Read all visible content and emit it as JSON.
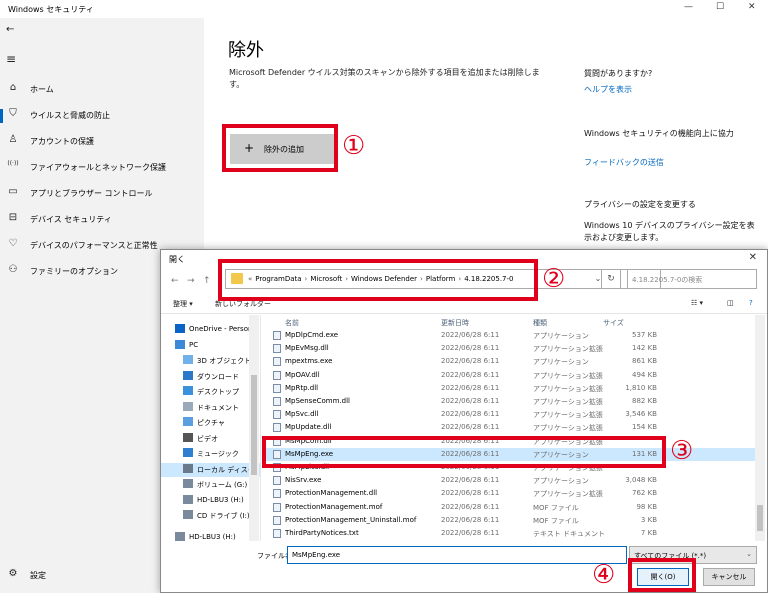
{
  "window": {
    "title": "Windows セキュリティ",
    "minimize": "—",
    "maximize": "☐",
    "close": "✕"
  },
  "sidebar": {
    "back_icon": "←",
    "menu_icon": "≡",
    "items": [
      {
        "icon": "⌂",
        "label": "ホーム",
        "selected": false
      },
      {
        "icon": "⛉",
        "label": "ウイルスと脅威の防止",
        "selected": true
      },
      {
        "icon": "♙",
        "label": "アカウントの保護",
        "selected": false
      },
      {
        "icon": "((·))",
        "label": "ファイアウォールとネットワーク保護",
        "selected": false
      },
      {
        "icon": "▭",
        "label": "アプリとブラウザー コントロール",
        "selected": false
      },
      {
        "icon": "⊟",
        "label": "デバイス セキュリティ",
        "selected": false
      },
      {
        "icon": "♡",
        "label": "デバイスのパフォーマンスと正常性",
        "selected": false
      },
      {
        "icon": "⚇",
        "label": "ファミリーのオプション",
        "selected": false
      }
    ],
    "settings": {
      "icon": "⚙",
      "label": "設定"
    }
  },
  "main": {
    "title": "除外",
    "description": "Microsoft Defender ウイルス対策のスキャンから除外する項目を追加または削除します。",
    "add_button": {
      "plus": "+",
      "label": "除外の追加"
    },
    "help": {
      "heading": "質問がありますか?",
      "link": "ヘルプを表示"
    },
    "improve": {
      "heading": "Windows セキュリティの機能向上に協力",
      "link": "フィードバックの送信"
    },
    "privacy": {
      "heading": "プライバシーの設定を変更する",
      "text": "Windows 10 デバイスのプライバシー設定を表示および変更します。"
    }
  },
  "annotations": [
    "①",
    "②",
    "③",
    "④"
  ],
  "dialog": {
    "title": "開く",
    "close": "✕",
    "nav": {
      "back": "←",
      "forward": "→",
      "up": "↑"
    },
    "breadcrumb": [
      "«",
      "ProgramData",
      "›",
      "Microsoft",
      "›",
      "Windows Defender",
      "›",
      "Platform",
      "›",
      "4.18.2205.7-0"
    ],
    "search_placeholder": "4.18.2205.7-0の検索",
    "toolbar": {
      "organize": "整理 ▾",
      "new_folder": "新しいフォルダー",
      "view": "☷ ▾",
      "pane": "◫",
      "help": "?"
    },
    "tree": [
      {
        "label": "OneDrive - Person",
        "icon_color": "#0a64c8",
        "indent": 14,
        "selected": false
      },
      {
        "label": "PC",
        "icon_color": "#3a8ad8",
        "indent": 14,
        "selected": false
      },
      {
        "label": "3D オブジェクト",
        "icon_color": "#6fb1e8",
        "indent": 22,
        "selected": false
      },
      {
        "label": "ダウンロード",
        "icon_color": "#2a78c8",
        "indent": 22,
        "selected": false
      },
      {
        "label": "デスクトップ",
        "icon_color": "#3c91dc",
        "indent": 22,
        "selected": false
      },
      {
        "label": "ドキュメント",
        "icon_color": "#9aa9bc",
        "indent": 22,
        "selected": false
      },
      {
        "label": "ピクチャ",
        "icon_color": "#5aa0e0",
        "indent": 22,
        "selected": false
      },
      {
        "label": "ビデオ",
        "icon_color": "#555555",
        "indent": 22,
        "selected": false
      },
      {
        "label": "ミュージック",
        "icon_color": "#2f7fd0",
        "indent": 22,
        "selected": false
      },
      {
        "label": "ローカル ディスク (C",
        "icon_color": "#6a7a8c",
        "indent": 22,
        "selected": true
      },
      {
        "label": "ボリューム (G:)",
        "icon_color": "#7a8a9c",
        "indent": 22,
        "selected": false
      },
      {
        "label": "HD-LBU3 (H:)",
        "icon_color": "#7a8a9c",
        "indent": 22,
        "selected": false
      },
      {
        "label": "CD ドライブ (I:)",
        "icon_color": "#7a8a9c",
        "indent": 22,
        "selected": false
      },
      {
        "label": "HD-LBU3 (H:)",
        "icon_color": "#7a8a9c",
        "indent": 14,
        "selected": false
      }
    ],
    "columns": {
      "name": "名前",
      "date": "更新日時",
      "type": "種類",
      "size": "サイズ"
    },
    "files": [
      {
        "name": "MpDlpCmd.exe",
        "date": "2022/06/28 6:11",
        "type": "アプリケーション",
        "size": "537 KB",
        "selected": false
      },
      {
        "name": "MpEvMsg.dll",
        "date": "2022/06/28 6:11",
        "type": "アプリケーション拡張",
        "size": "142 KB",
        "selected": false
      },
      {
        "name": "mpextms.exe",
        "date": "2022/06/28 6:11",
        "type": "アプリケーション",
        "size": "861 KB",
        "selected": false
      },
      {
        "name": "MpOAV.dll",
        "date": "2022/06/28 6:11",
        "type": "アプリケーション拡張",
        "size": "494 KB",
        "selected": false
      },
      {
        "name": "MpRtp.dll",
        "date": "2022/06/28 6:11",
        "type": "アプリケーション拡張",
        "size": "1,810 KB",
        "selected": false
      },
      {
        "name": "MpSenseComm.dll",
        "date": "2022/06/28 6:11",
        "type": "アプリケーション拡張",
        "size": "882 KB",
        "selected": false
      },
      {
        "name": "MpSvc.dll",
        "date": "2022/06/28 6:11",
        "type": "アプリケーション拡張",
        "size": "3,546 KB",
        "selected": false
      },
      {
        "name": "MpUpdate.dll",
        "date": "2022/06/28 6:11",
        "type": "アプリケーション拡張",
        "size": "154 KB",
        "selected": false
      },
      {
        "name": "MsMpCom.dll",
        "date": "2022/06/28 6:11",
        "type": "アプリケーション拡張",
        "size": "",
        "selected": false
      },
      {
        "name": "MsMpEng.exe",
        "date": "2022/06/28 6:11",
        "type": "アプリケーション",
        "size": "131 KB",
        "selected": true
      },
      {
        "name": "MsMpLics.dll",
        "date": "2022/06/28 6:11",
        "type": "アプリケーション拡張",
        "size": "",
        "selected": false
      },
      {
        "name": "NisSrv.exe",
        "date": "2022/06/28 6:11",
        "type": "アプリケーション",
        "size": "3,048 KB",
        "selected": false
      },
      {
        "name": "ProtectionManagement.dll",
        "date": "2022/06/28 6:11",
        "type": "アプリケーション拡張",
        "size": "762 KB",
        "selected": false
      },
      {
        "name": "ProtectionManagement.mof",
        "date": "2022/06/28 6:11",
        "type": "MOF ファイル",
        "size": "98 KB",
        "selected": false
      },
      {
        "name": "ProtectionManagement_Uninstall.mof",
        "date": "2022/06/28 6:11",
        "type": "MOF ファイル",
        "size": "3 KB",
        "selected": false
      },
      {
        "name": "ThirdPartyNotices.txt",
        "date": "2022/06/28 6:11",
        "type": "テキスト ドキュメント",
        "size": "7 KB",
        "selected": false
      }
    ],
    "filename_label": "ファイル名(N):",
    "filename_value": "MsMpEng.exe",
    "filetype": "すべてのファイル (*.*)",
    "filetype_dd": "⌄",
    "open_button": "開く(O)",
    "cancel_button": "キャンセル"
  },
  "colors": {
    "accent": "#0067c0",
    "annotation_red": "#e0001b",
    "sidebar_bg": "#f2f2f2",
    "selected_row": "#cce8ff"
  }
}
